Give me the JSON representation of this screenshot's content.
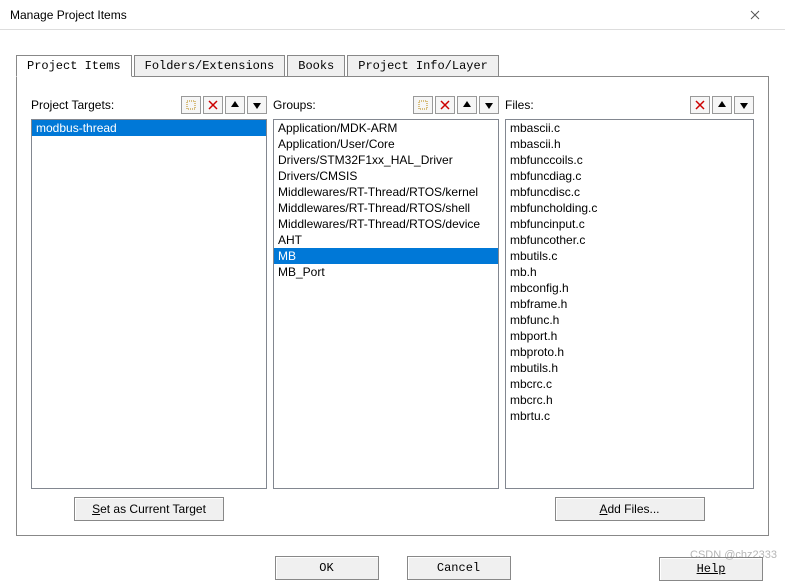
{
  "window": {
    "title": "Manage Project Items"
  },
  "tabs": [
    {
      "label": "Project Items",
      "active": true
    },
    {
      "label": "Folders/Extensions",
      "active": false
    },
    {
      "label": "Books",
      "active": false
    },
    {
      "label": "Project Info/Layer",
      "active": false
    }
  ],
  "columns": {
    "targets": {
      "label": "Project Targets:",
      "toolbar": [
        "new",
        "delete",
        "up",
        "down"
      ],
      "items": [
        {
          "label": "modbus-thread",
          "selected": true
        }
      ],
      "button": "Set as Current Target"
    },
    "groups": {
      "label": "Groups:",
      "toolbar": [
        "new",
        "delete",
        "up",
        "down"
      ],
      "items": [
        {
          "label": "Application/MDK-ARM",
          "selected": false
        },
        {
          "label": "Application/User/Core",
          "selected": false
        },
        {
          "label": "Drivers/STM32F1xx_HAL_Driver",
          "selected": false
        },
        {
          "label": "Drivers/CMSIS",
          "selected": false
        },
        {
          "label": "Middlewares/RT-Thread/RTOS/kernel",
          "selected": false
        },
        {
          "label": "Middlewares/RT-Thread/RTOS/shell",
          "selected": false
        },
        {
          "label": "Middlewares/RT-Thread/RTOS/device",
          "selected": false
        },
        {
          "label": "AHT",
          "selected": false
        },
        {
          "label": "MB",
          "selected": true
        },
        {
          "label": "MB_Port",
          "selected": false
        }
      ]
    },
    "files": {
      "label": "Files:",
      "toolbar": [
        "delete",
        "up",
        "down"
      ],
      "items": [
        {
          "label": "mbascii.c"
        },
        {
          "label": "mbascii.h"
        },
        {
          "label": "mbfunccoils.c"
        },
        {
          "label": "mbfuncdiag.c"
        },
        {
          "label": "mbfuncdisc.c"
        },
        {
          "label": "mbfuncholding.c"
        },
        {
          "label": "mbfuncinput.c"
        },
        {
          "label": "mbfuncother.c"
        },
        {
          "label": "mbutils.c"
        },
        {
          "label": "mb.h"
        },
        {
          "label": "mbconfig.h"
        },
        {
          "label": "mbframe.h"
        },
        {
          "label": "mbfunc.h"
        },
        {
          "label": "mbport.h"
        },
        {
          "label": "mbproto.h"
        },
        {
          "label": "mbutils.h"
        },
        {
          "label": "mbcrc.c"
        },
        {
          "label": "mbcrc.h"
        },
        {
          "label": "mbrtu.c"
        }
      ],
      "button": "Add Files..."
    }
  },
  "buttons": {
    "ok": "OK",
    "cancel": "Cancel",
    "help": "Help"
  },
  "watermark": "CSDN @chz2333"
}
